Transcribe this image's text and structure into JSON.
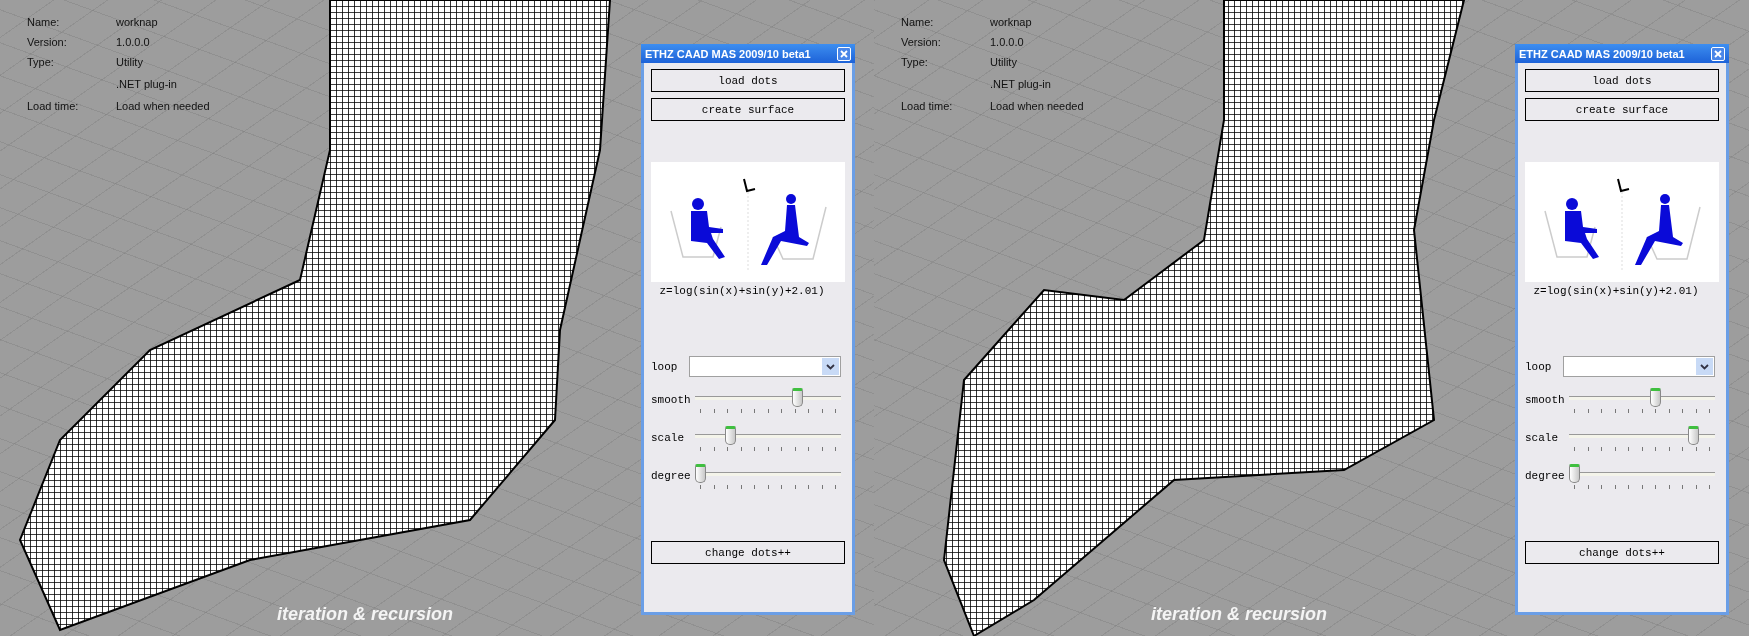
{
  "viewports": [
    {
      "info": [
        {
          "label": "Name:",
          "value": "worknap"
        },
        {
          "label": "Version:",
          "value": "1.0.0.0"
        },
        {
          "label": "Type:",
          "value": "Utility"
        },
        {
          "value": ".NET plug-in"
        },
        {
          "label": "Load time:",
          "value": "Load when needed"
        }
      ],
      "caption": "iteration & recursion",
      "panel": {
        "title": "ETHZ CAAD MAS 2009/10 beta1",
        "top_buttons": [
          "load dots",
          "create surface"
        ],
        "formula": "z=log(sin(x)+sin(y)+2.01)",
        "dropdown_label": "loop",
        "sliders": [
          {
            "label": "smooth",
            "level": 0.72
          },
          {
            "label": "scale",
            "level": 0.22
          },
          {
            "label": "degree",
            "level": 0
          }
        ],
        "bottom_button": "change dots++"
      }
    },
    {
      "info": [
        {
          "label": "Name:",
          "value": "worknap"
        },
        {
          "label": "Version:",
          "value": "1.0.0.0"
        },
        {
          "label": "Type:",
          "value": "Utility"
        },
        {
          "value": ".NET plug-in"
        },
        {
          "label": "Load time:",
          "value": "Load when needed"
        }
      ],
      "caption": "iteration & recursion",
      "panel": {
        "title": "ETHZ CAAD MAS 2009/10 beta1",
        "top_buttons": [
          "load dots",
          "create surface"
        ],
        "formula": "z=log(sin(x)+sin(y)+2.01)",
        "dropdown_label": "loop",
        "sliders": [
          {
            "label": "smooth",
            "level": 0.6
          },
          {
            "label": "scale",
            "level": 0.88
          },
          {
            "label": "degree",
            "level": 0
          }
        ],
        "bottom_button": "change dots++"
      }
    }
  ]
}
